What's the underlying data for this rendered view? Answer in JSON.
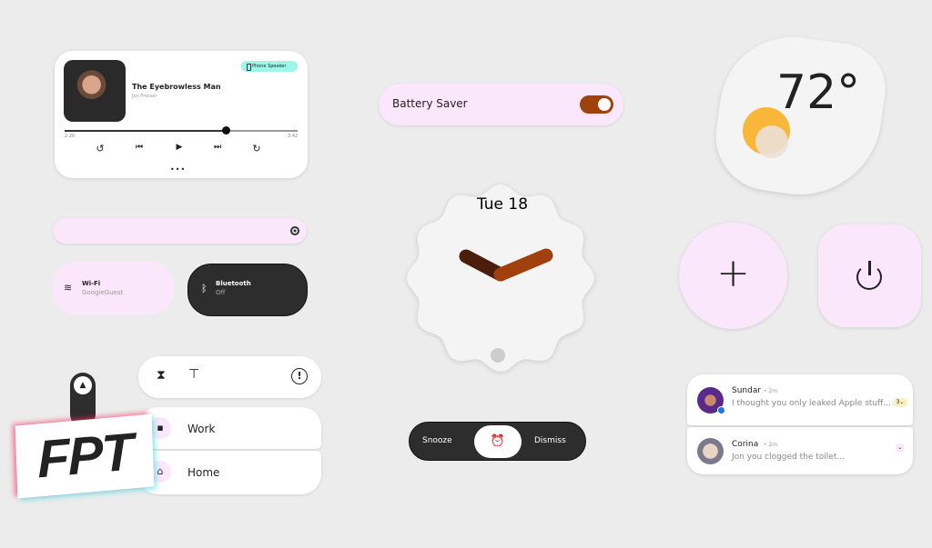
{
  "media": {
    "title": "The Eyebrowless Man",
    "artist": "Jon Prosser",
    "output": "Phone Speaker",
    "elapsed": "2:20",
    "duration": "3:42",
    "progress_percent": 63,
    "controls": {
      "replay": "↺",
      "prev": "⏮",
      "play": "▶",
      "next": "⏭",
      "forward": "↻"
    },
    "pager": "•••"
  },
  "brightness": {
    "icon": "brightness-icon",
    "level_percent": 100
  },
  "tiles": [
    {
      "label": "Wi-Fi",
      "status": "GoogleGuest",
      "icon": "wifi-icon"
    },
    {
      "label": "Bluetooth",
      "status": "Off",
      "icon": "bluetooth-icon"
    }
  ],
  "toolbar": {
    "icons": [
      "hourglass-icon",
      "pin-icon",
      "alert-icon"
    ]
  },
  "shortcuts": [
    {
      "label": "Work"
    },
    {
      "label": "Home"
    }
  ],
  "logo": "FPT",
  "battery": {
    "label": "Battery Saver",
    "on": true,
    "accent": "#a0410d"
  },
  "clock": {
    "date": "Tue 18",
    "hour_color": "#4a1e0a",
    "minute_color": "#a0410d"
  },
  "alarm": {
    "snooze": "Snooze",
    "dismiss": "Dismiss"
  },
  "weather": {
    "temp": "72°",
    "icon": "partly-cloudy-icon"
  },
  "buttons": {
    "add": "+",
    "power": "power-icon"
  },
  "notifications": [
    {
      "name": "Sundar",
      "time": "• 2m",
      "text": "I thought you only leaked Apple stuff...",
      "count": "3"
    },
    {
      "name": "Corina",
      "time": "• 2m",
      "text": "Jon you clogged the toilet..."
    }
  ]
}
